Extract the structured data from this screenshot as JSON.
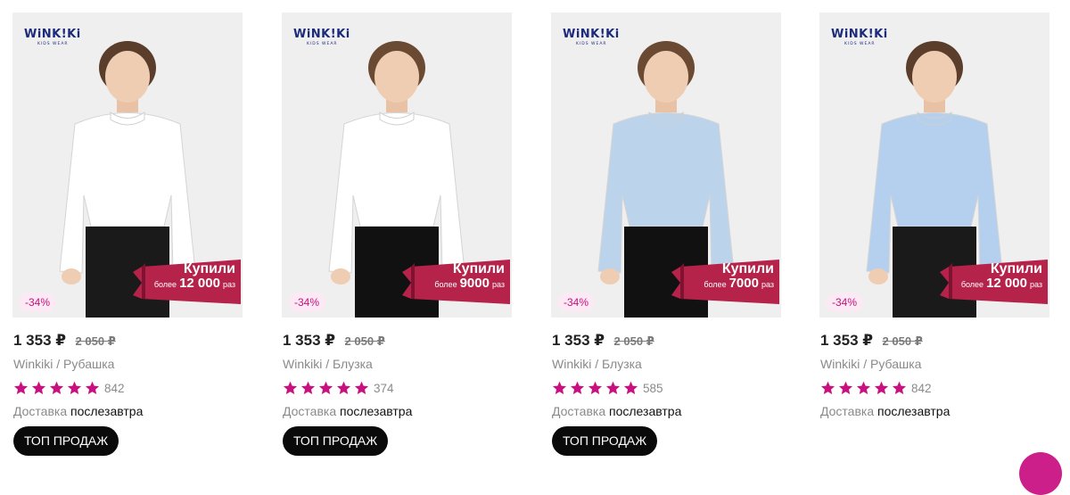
{
  "accent_color": "#c8117f",
  "banner_color": "#b5224a",
  "products": [
    {
      "brand_logo": "WiNK!Ki",
      "brand_sub": "KIDS WEAR",
      "shirt_color": "#ffffff",
      "pants_color": "#1a1a1a",
      "hair_color": "#5a3e2b",
      "banner_title": "Купили",
      "banner_prefix": "более",
      "banner_count": "12 000",
      "banner_suffix": "раз",
      "discount": "-34%",
      "price": "1 353 ₽",
      "old_price": "2 050 ₽",
      "title": "Winkiki / Рубашка",
      "rating": 5,
      "reviews": "842",
      "delivery_label": "Доставка",
      "delivery_value": "послезавтра",
      "badge": "ТОП ПРОДАЖ"
    },
    {
      "brand_logo": "WiNK!Ki",
      "brand_sub": "KIDS WEAR",
      "shirt_color": "#ffffff",
      "pants_color": "#111111",
      "hair_color": "#6b4a33",
      "banner_title": "Купили",
      "banner_prefix": "более",
      "banner_count": "9000",
      "banner_suffix": "раз",
      "discount": "-34%",
      "price": "1 353 ₽",
      "old_price": "2 050 ₽",
      "title": "Winkiki / Блузка",
      "rating": 5,
      "reviews": "374",
      "delivery_label": "Доставка",
      "delivery_value": "послезавтра",
      "badge": "ТОП ПРОДАЖ"
    },
    {
      "brand_logo": "WiNK!Ki",
      "brand_sub": "KIDS WEAR",
      "shirt_color": "#bcd3ec",
      "pants_color": "#111111",
      "hair_color": "#6b4a33",
      "banner_title": "Купили",
      "banner_prefix": "более",
      "banner_count": "7000",
      "banner_suffix": "раз",
      "discount": "-34%",
      "price": "1 353 ₽",
      "old_price": "2 050 ₽",
      "title": "Winkiki / Блузка",
      "rating": 5,
      "reviews": "585",
      "delivery_label": "Доставка",
      "delivery_value": "послезавтра",
      "badge": "ТОП ПРОДАЖ"
    },
    {
      "brand_logo": "WiNK!Ki",
      "brand_sub": "KIDS WEAR",
      "shirt_color": "#b5d0ee",
      "pants_color": "#1a1a1a",
      "hair_color": "#5a3e2b",
      "banner_title": "Купили",
      "banner_prefix": "более",
      "banner_count": "12 000",
      "banner_suffix": "раз",
      "discount": "-34%",
      "price": "1 353 ₽",
      "old_price": "2 050 ₽",
      "title": "Winkiki / Рубашка",
      "rating": 5,
      "reviews": "842",
      "delivery_label": "Доставка",
      "delivery_value": "послезавтра",
      "badge": null
    }
  ]
}
